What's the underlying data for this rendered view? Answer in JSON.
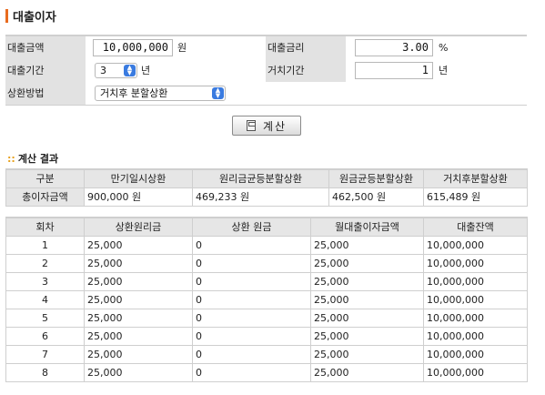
{
  "page": {
    "title": "대출이자"
  },
  "form": {
    "loan_amount": {
      "label": "대출금액",
      "value": "10,000,000",
      "unit": "원"
    },
    "loan_rate": {
      "label": "대출금리",
      "value": "3.00",
      "unit": "%"
    },
    "loan_period": {
      "label": "대출기간",
      "value": "3",
      "unit": "년"
    },
    "grace_period": {
      "label": "거치기간",
      "value": "1",
      "unit": "년"
    },
    "repay_method": {
      "label": "상환방법",
      "value": "거치후 분할상환"
    }
  },
  "calc_button": {
    "label": "계산",
    "icon": "calculator-icon"
  },
  "result": {
    "mark": "::",
    "title": "계산 결과",
    "summary": {
      "headers": [
        "구분",
        "만기일시상환",
        "원리금균등분할상환",
        "원금균등분할상환",
        "거치후분할상환"
      ],
      "row_label": "총이자금액",
      "values": [
        "900,000 원",
        "469,233 원",
        "462,500 원",
        "615,489 원"
      ]
    },
    "schedule": {
      "headers": [
        "회차",
        "상환원리금",
        "상환 원금",
        "월대출이자금액",
        "대출잔액"
      ],
      "rows": [
        [
          "1",
          "25,000",
          "0",
          "25,000",
          "10,000,000"
        ],
        [
          "2",
          "25,000",
          "0",
          "25,000",
          "10,000,000"
        ],
        [
          "3",
          "25,000",
          "0",
          "25,000",
          "10,000,000"
        ],
        [
          "4",
          "25,000",
          "0",
          "25,000",
          "10,000,000"
        ],
        [
          "5",
          "25,000",
          "0",
          "25,000",
          "10,000,000"
        ],
        [
          "6",
          "25,000",
          "0",
          "25,000",
          "10,000,000"
        ],
        [
          "7",
          "25,000",
          "0",
          "25,000",
          "10,000,000"
        ],
        [
          "8",
          "25,000",
          "0",
          "25,000",
          "10,000,000"
        ]
      ]
    }
  },
  "colors": {
    "title_accent": "#e86b1f",
    "header_bg": "#e6e6e6",
    "select_arrow": "#3a7be0",
    "result_mark": "#e8a21f"
  }
}
